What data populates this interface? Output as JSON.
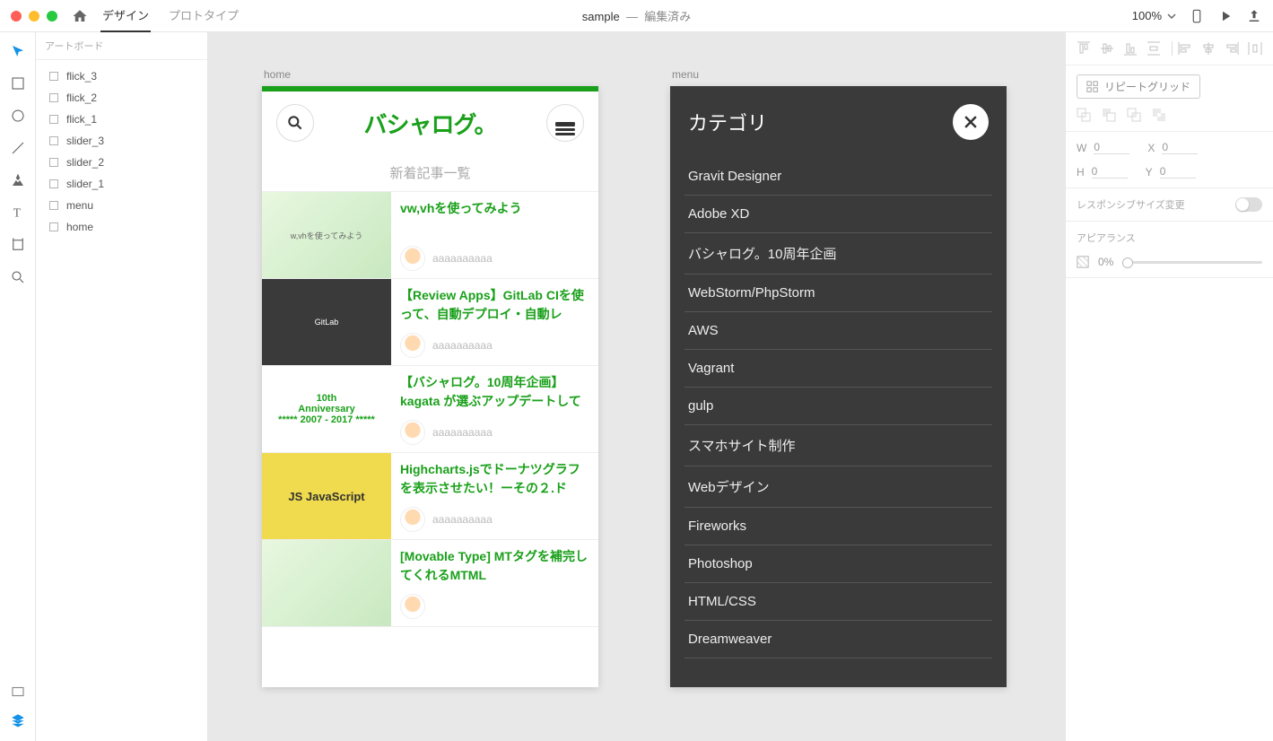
{
  "topbar": {
    "tabs": {
      "design": "デザイン",
      "prototype": "プロトタイプ"
    },
    "doc_name": "sample",
    "doc_sep": "—",
    "doc_status": "編集済み",
    "zoom": "100%"
  },
  "layers": {
    "header": "アートボード",
    "items": [
      "flick_3",
      "flick_2",
      "flick_1",
      "slider_3",
      "slider_2",
      "slider_1",
      "menu",
      "home"
    ]
  },
  "canvas": {
    "artboards": {
      "home": {
        "label": "home",
        "logo": "バシャログ。",
        "subhead": "新着記事一覧",
        "articles": [
          {
            "title": "vw,vhを使ってみよう",
            "author": "aaaaaaaaaa",
            "thumb_text": "w,vhを使ってみよう"
          },
          {
            "title": "【Review Apps】GitLab CIを使って、自動デプロイ・自動レ",
            "author": "aaaaaaaaaa",
            "thumb_text": "GitLab"
          },
          {
            "title": "【バシャログ。10周年企画】kagata が選ぶアップデートして",
            "author": "aaaaaaaaaa",
            "thumb_text": "10th\nAnniversary\n***** 2007 - 2017 *****"
          },
          {
            "title": "Highcharts.jsでドーナツグラフを表示させたい！ーその２.ド",
            "author": "aaaaaaaaaa",
            "thumb_text": "JS  JavaScript"
          },
          {
            "title": "[Movable Type] MTタグを補完してくれるMTML",
            "author": "",
            "thumb_text": ""
          }
        ]
      },
      "menu": {
        "label": "menu",
        "title": "カテゴリ",
        "items": [
          "Gravit Designer",
          "Adobe XD",
          "バシャログ。10周年企画",
          "WebStorm/PhpStorm",
          "AWS",
          "Vagrant",
          "gulp",
          "スマホサイト制作",
          "Webデザイン",
          "Fireworks",
          "Photoshop",
          "HTML/CSS",
          "Dreamweaver"
        ]
      }
    }
  },
  "rpanel": {
    "repeat": "リピートグリッド",
    "dims": {
      "w_label": "W",
      "w": "0",
      "x_label": "X",
      "x": "0",
      "h_label": "H",
      "h": "0",
      "y_label": "Y",
      "y": "0"
    },
    "responsive": "レスポンシブサイズ変更",
    "appearance": "アピアランス",
    "opacity": "0%"
  }
}
